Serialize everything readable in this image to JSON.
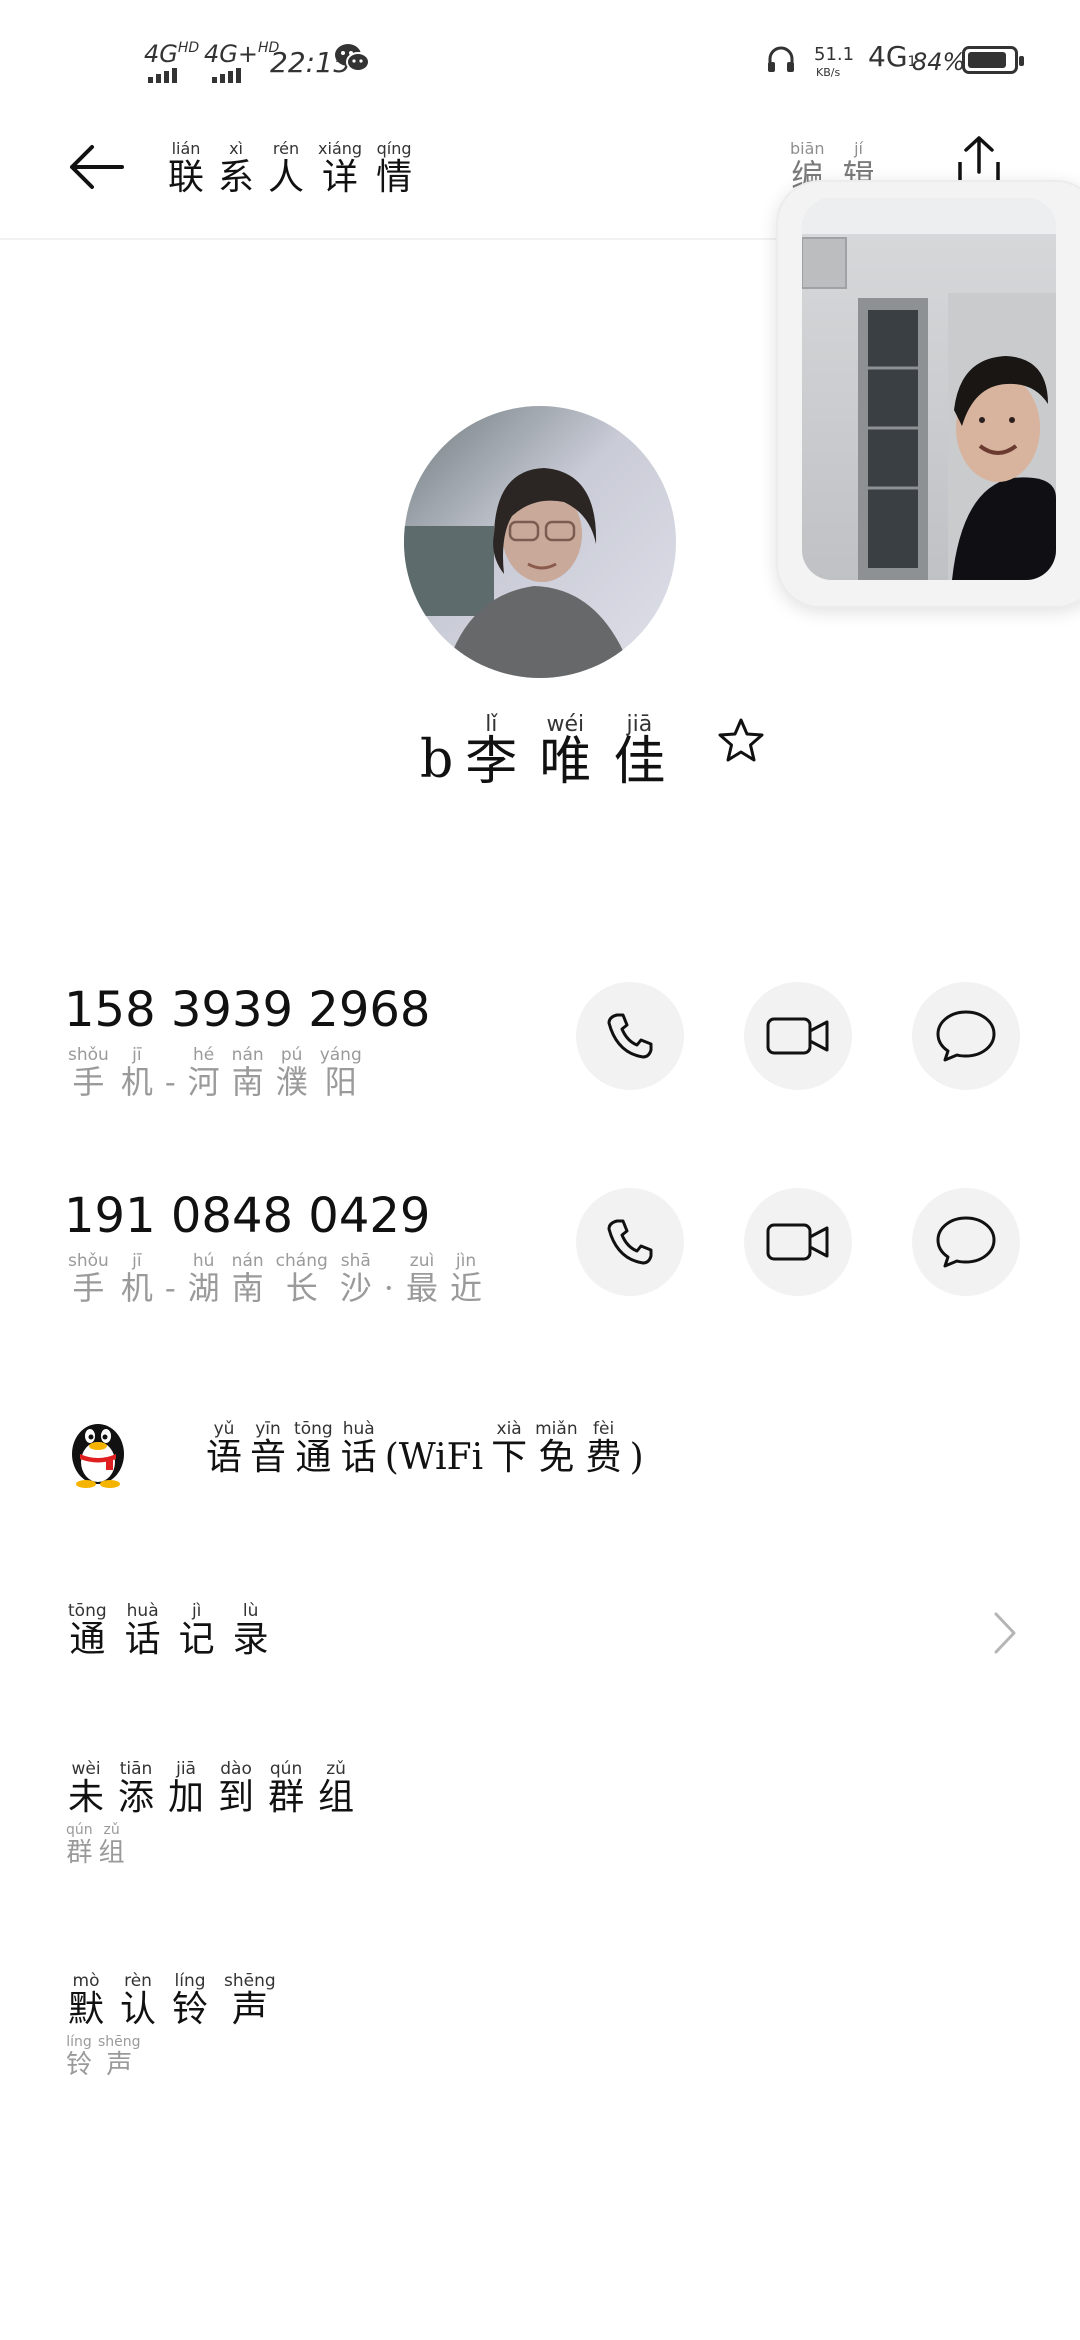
{
  "status_bar": {
    "net1": "4G",
    "net1_sup": "HD",
    "net2": "4G+",
    "net2_sup": "HD",
    "time": "22:15",
    "speed": "51.1",
    "speed_unit": "KB/s",
    "net3": "4G",
    "net3_sub": "1",
    "battery": "84%",
    "icons": [
      "wechat-icon",
      "headphones-icon",
      "battery-icon"
    ]
  },
  "header": {
    "title": [
      {
        "hz": "联",
        "py": "lián"
      },
      {
        "hz": "系",
        "py": "xì"
      },
      {
        "hz": "人",
        "py": "rén"
      },
      {
        "hz": "详",
        "py": "xiáng"
      },
      {
        "hz": "情",
        "py": "qíng"
      }
    ],
    "edit": [
      {
        "hz": "编",
        "py": "biān"
      },
      {
        "hz": "辑",
        "py": "jí"
      }
    ],
    "icons": [
      "back-arrow-icon",
      "share-icon"
    ]
  },
  "contact": {
    "name_latin": "b",
    "name": [
      {
        "hz": "李",
        "py": "lǐ"
      },
      {
        "hz": "唯",
        "py": "wéi"
      },
      {
        "hz": "佳",
        "py": "jiā"
      }
    ],
    "favorite_icon": "star-outline-icon"
  },
  "phones": [
    {
      "number": "158 3939 2968",
      "label": [
        {
          "hz": "手",
          "py": "shǒu"
        },
        {
          "hz": "机",
          "py": "jī"
        },
        {
          "hz": "-",
          "py": ""
        },
        {
          "hz": "河",
          "py": "hé"
        },
        {
          "hz": "南",
          "py": "nán"
        },
        {
          "hz": "濮",
          "py": "pú"
        },
        {
          "hz": "阳",
          "py": "yáng"
        }
      ]
    },
    {
      "number": "191 0848 0429",
      "label": [
        {
          "hz": "手",
          "py": "shǒu"
        },
        {
          "hz": "机",
          "py": "jī"
        },
        {
          "hz": "-",
          "py": ""
        },
        {
          "hz": "湖",
          "py": "hú"
        },
        {
          "hz": "南",
          "py": "nán"
        },
        {
          "hz": "长",
          "py": "cháng"
        },
        {
          "hz": "沙",
          "py": "shā"
        },
        {
          "hz": "·",
          "py": ""
        },
        {
          "hz": "最",
          "py": "zuì"
        },
        {
          "hz": "近",
          "py": "jìn"
        }
      ]
    }
  ],
  "qq_voice": [
    {
      "hz": "语",
      "py": "yǔ"
    },
    {
      "hz": "音",
      "py": "yīn"
    },
    {
      "hz": "通",
      "py": "tōng"
    },
    {
      "hz": "话",
      "py": "huà"
    },
    {
      "hz": "(WiFi",
      "py": ""
    },
    {
      "hz": "下",
      "py": "xià"
    },
    {
      "hz": "免",
      "py": "miǎn"
    },
    {
      "hz": "费",
      "py": "fèi"
    },
    {
      "hz": ")",
      "py": ""
    }
  ],
  "call_log": [
    {
      "hz": "通",
      "py": "tōng"
    },
    {
      "hz": "话",
      "py": "huà"
    },
    {
      "hz": "记",
      "py": "jì"
    },
    {
      "hz": "录",
      "py": "lù"
    }
  ],
  "group": {
    "title": [
      {
        "hz": "未",
        "py": "wèi"
      },
      {
        "hz": "添",
        "py": "tiān"
      },
      {
        "hz": "加",
        "py": "jiā"
      },
      {
        "hz": "到",
        "py": "dào"
      },
      {
        "hz": "群",
        "py": "qún"
      },
      {
        "hz": "组",
        "py": "zǔ"
      }
    ],
    "sub": [
      {
        "hz": "群",
        "py": "qún"
      },
      {
        "hz": "组",
        "py": "zǔ"
      }
    ]
  },
  "ringtone": {
    "title": [
      {
        "hz": "默",
        "py": "mò"
      },
      {
        "hz": "认",
        "py": "rèn"
      },
      {
        "hz": "铃",
        "py": "líng"
      },
      {
        "hz": "声",
        "py": "shēng"
      }
    ],
    "sub": [
      {
        "hz": "铃",
        "py": "líng"
      },
      {
        "hz": "声",
        "py": "shēng"
      }
    ]
  }
}
